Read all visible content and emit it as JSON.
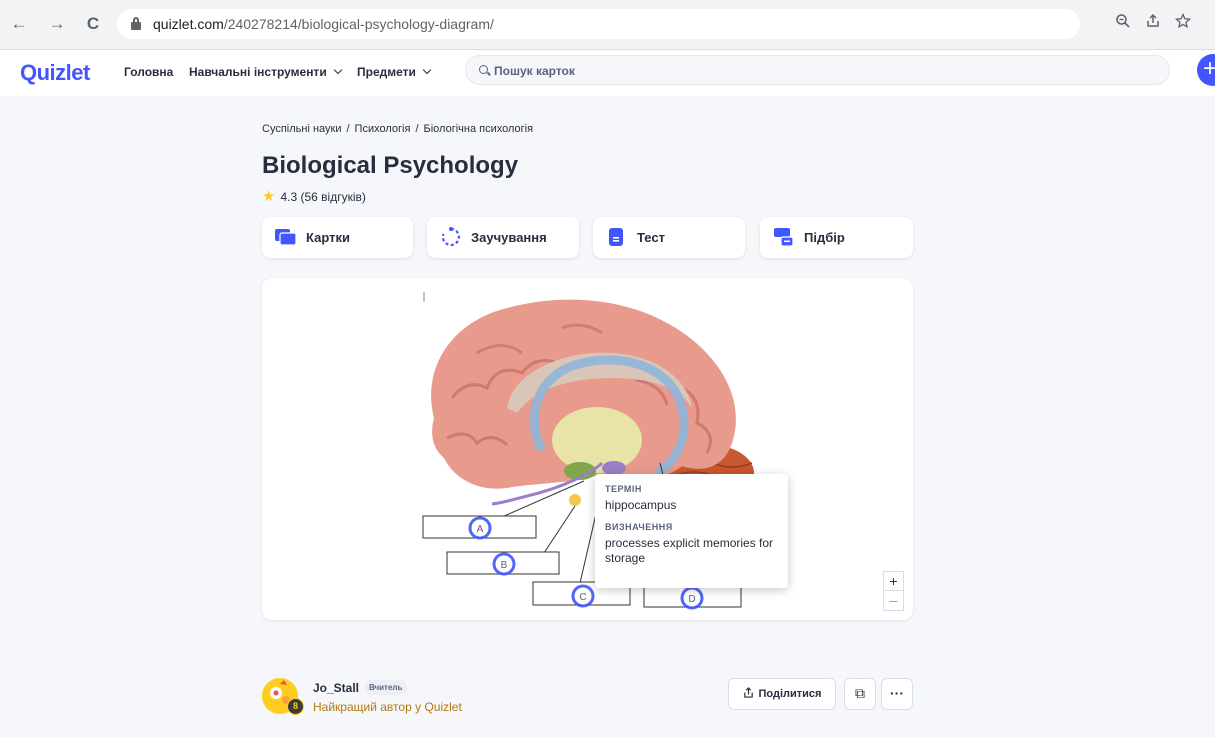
{
  "browser": {
    "url_host": "quizlet.com",
    "url_path": "/240278214/biological-psychology-diagram/",
    "back_glyph": "←",
    "forward_glyph": "→",
    "reload_glyph": "C"
  },
  "header": {
    "logo": "Quizlet",
    "nav": [
      {
        "label": "Головна"
      },
      {
        "label": "Навчальні інструменти"
      },
      {
        "label": "Предмети"
      }
    ],
    "search_placeholder": "Пошук карток",
    "create_glyph": "+"
  },
  "breadcrumb": [
    "Суспільні науки",
    "Психологія",
    "Біологічна психологія"
  ],
  "set": {
    "title": "Biological Psychology",
    "rating": "4.3 (56 відгуків)"
  },
  "modes": [
    {
      "label": "Картки",
      "icon": "cards-icon"
    },
    {
      "label": "Заучування",
      "icon": "learn-icon"
    },
    {
      "label": "Тест",
      "icon": "test-icon"
    },
    {
      "label": "Підбір",
      "icon": "match-icon"
    }
  ],
  "diagram": {
    "markers": [
      "A",
      "B",
      "C",
      "D"
    ],
    "tooltip": {
      "term_heading": "ТЕРМІН",
      "term": "hippocampus",
      "definition_heading": "ВИЗНАЧЕННЯ",
      "definition": "processes explicit memories for storage"
    },
    "zoom_in": "+",
    "zoom_out": "–"
  },
  "author": {
    "name": "Jo_Stall",
    "role": "Вчитель",
    "top_creator_prefix": "Найкращий автор у",
    "top_creator_suffix": "Quizlet"
  },
  "actions": {
    "share": "Поділитися",
    "copy_glyph": "⧉",
    "more_glyph": "···"
  },
  "colors": {
    "brand": "#4255ff",
    "star": "#ffcd1f",
    "gold_text": "#b5790c"
  }
}
